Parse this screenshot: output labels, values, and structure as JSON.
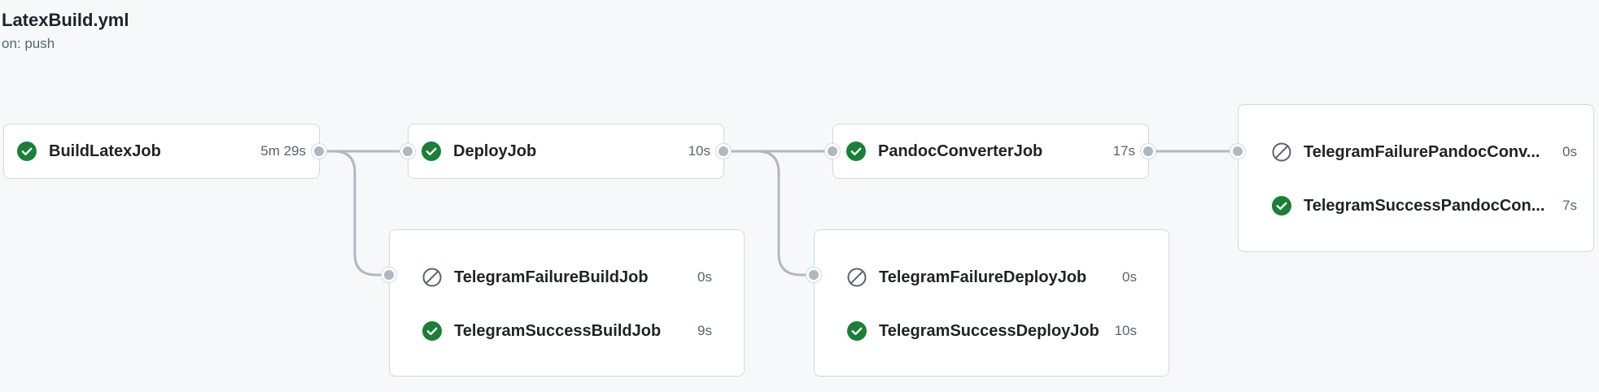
{
  "workflow": {
    "title": "LatexBuild.yml",
    "trigger": "on: push"
  },
  "colors": {
    "success": "#1a7f37",
    "skipped": "#59636e",
    "connector": "#afb8c1"
  },
  "jobs": {
    "build_latex": {
      "name": "BuildLatexJob",
      "duration": "5m 29s",
      "status": "success"
    },
    "deploy": {
      "name": "DeployJob",
      "duration": "10s",
      "status": "success"
    },
    "pandoc": {
      "name": "PandocConverterJob",
      "duration": "17s",
      "status": "success"
    },
    "tg_failure_build": {
      "name": "TelegramFailureBuildJob",
      "duration": "0s",
      "status": "skipped"
    },
    "tg_success_build": {
      "name": "TelegramSuccessBuildJob",
      "duration": "9s",
      "status": "success"
    },
    "tg_failure_deploy": {
      "name": "TelegramFailureDeployJob",
      "duration": "0s",
      "status": "skipped"
    },
    "tg_success_deploy": {
      "name": "TelegramSuccessDeployJob",
      "duration": "10s",
      "status": "success"
    },
    "tg_failure_pandoc": {
      "name": "TelegramFailurePandocConv...",
      "duration": "0s",
      "status": "skipped"
    },
    "tg_success_pandoc": {
      "name": "TelegramSuccessPandocCon...",
      "duration": "7s",
      "status": "success"
    }
  },
  "icons": {
    "success": "check-circle-fill-icon",
    "skipped": "skip-icon"
  }
}
